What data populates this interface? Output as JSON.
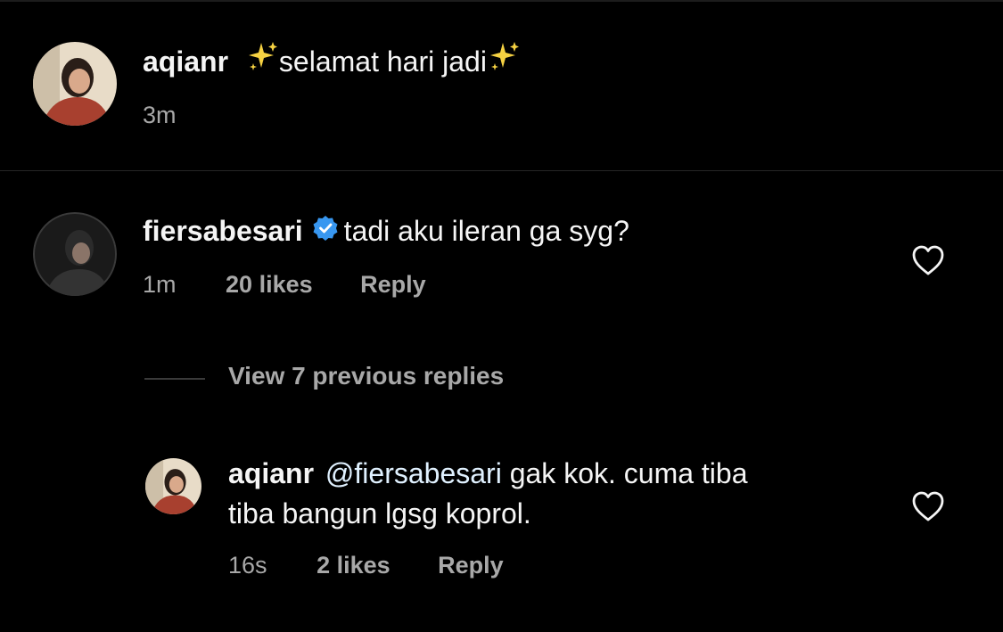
{
  "comments": [
    {
      "username": "aqianr",
      "sparkle_left": "sparkle-icon",
      "text": "selamat hari jadi",
      "sparkle_right": "sparkle-icon",
      "time": "3m"
    },
    {
      "username": "fiersabesari",
      "verified": true,
      "text": "tadi aku ileran ga syg?",
      "time": "1m",
      "likes": "20 likes",
      "reply_label": "Reply"
    }
  ],
  "view_previous": "View 7 previous replies",
  "reply": {
    "username": "aqianr",
    "mention": "@fiersabesari",
    "text_line1": " gak kok. cuma tiba",
    "text_line2": "tiba bangun lgsg koprol.",
    "time": "16s",
    "likes": "2 likes",
    "reply_label": "Reply"
  },
  "colors": {
    "background": "#000000",
    "secondary_text": "#a8a8a8",
    "verified_badge": "#3897f0",
    "sparkle": "#f5d142"
  },
  "icons": [
    "heart-icon",
    "verified-badge-icon",
    "sparkle-icon"
  ]
}
